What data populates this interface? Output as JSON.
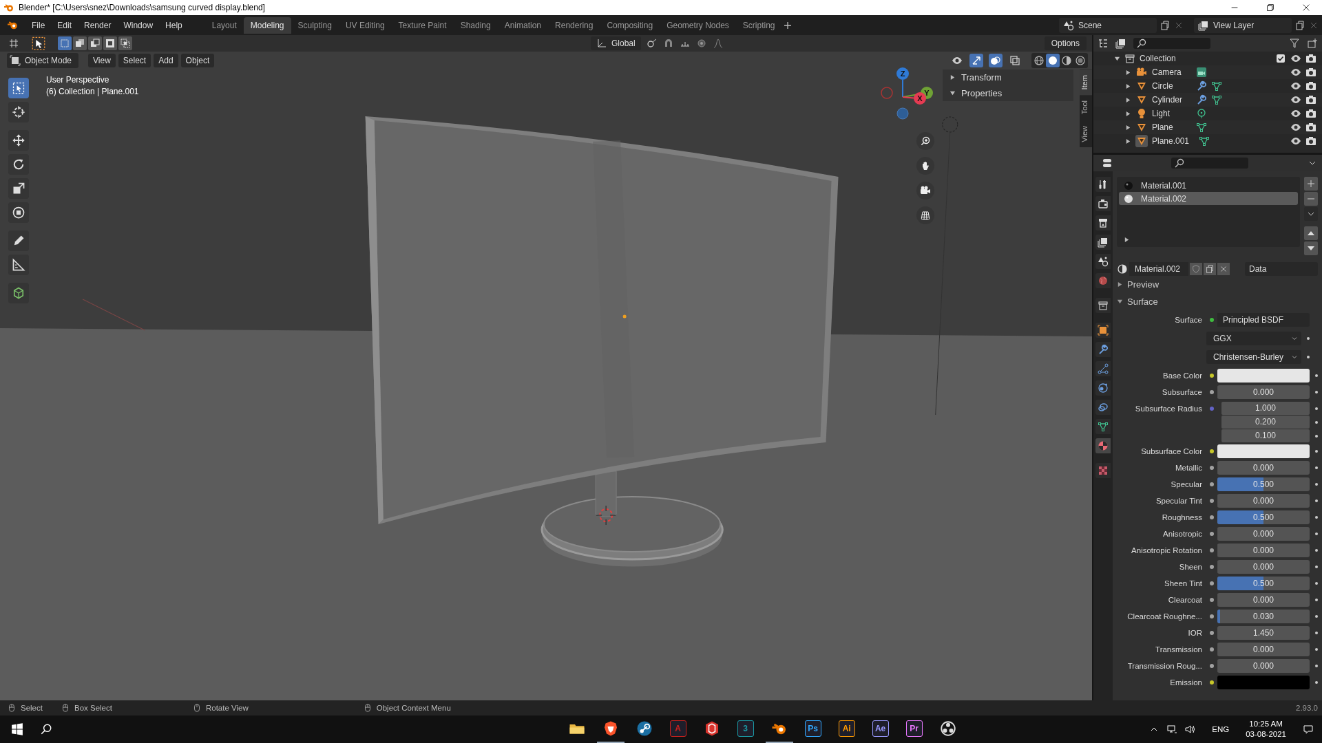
{
  "window": {
    "title": "Blender* [C:\\Users\\snez\\Downloads\\samsung curved display.blend]"
  },
  "menu": [
    "File",
    "Edit",
    "Render",
    "Window",
    "Help"
  ],
  "workspaces": [
    {
      "label": "Layout",
      "selected": false
    },
    {
      "label": "Modeling",
      "selected": true
    },
    {
      "label": "Sculpting",
      "selected": false
    },
    {
      "label": "UV Editing",
      "selected": false
    },
    {
      "label": "Texture Paint",
      "selected": false
    },
    {
      "label": "Shading",
      "selected": false
    },
    {
      "label": "Animation",
      "selected": false
    },
    {
      "label": "Rendering",
      "selected": false
    },
    {
      "label": "Compositing",
      "selected": false
    },
    {
      "label": "Geometry Nodes",
      "selected": false
    },
    {
      "label": "Scripting",
      "selected": false
    }
  ],
  "scene": "Scene",
  "view_layer": "View Layer",
  "viewport": {
    "select_modes": [
      {
        "kind": "sel-new",
        "selected": true
      },
      {
        "kind": "sel-extend",
        "selected": false
      },
      {
        "kind": "sel-subtract",
        "selected": false
      },
      {
        "kind": "sel-invert",
        "selected": false
      },
      {
        "kind": "sel-intersect",
        "selected": false
      }
    ],
    "orientation": "Global",
    "options": "Options",
    "mode": "Object Mode",
    "menus": [
      "View",
      "Select",
      "Add",
      "Object"
    ],
    "toggles": [
      {
        "kind": "eye",
        "on": false
      },
      {
        "kind": "gizmo",
        "on": true
      },
      {
        "kind": "overlay",
        "on": true
      },
      {
        "kind": "xray",
        "on": false
      }
    ],
    "shading": [
      {
        "kind": "wireframe",
        "selected": false
      },
      {
        "kind": "solid",
        "selected": true
      },
      {
        "kind": "material",
        "selected": false
      },
      {
        "kind": "rendered",
        "selected": false
      }
    ],
    "tools": [
      {
        "kind": "select-box",
        "selected": true
      },
      {
        "kind": "cursor",
        "selected": false
      },
      {
        "kind": "move",
        "selected": false
      },
      {
        "kind": "rotate",
        "selected": false
      },
      {
        "kind": "scale",
        "selected": false
      },
      {
        "kind": "transform",
        "selected": false
      },
      {
        "kind": "pencil",
        "selected": false
      },
      {
        "kind": "ruler",
        "selected": false
      },
      {
        "kind": "cube",
        "selected": false
      }
    ],
    "info": [
      "User Perspective",
      "(6) Collection | Plane.001"
    ],
    "axes": [
      {
        "label": "Z",
        "color": "#2f7ad6"
      },
      {
        "label": "Y",
        "color": "#6fa235"
      },
      {
        "label": "X",
        "color": "#e53b52"
      }
    ],
    "panels": [
      {
        "label": "Transform",
        "expanded": false
      },
      {
        "label": "Properties",
        "expanded": true
      }
    ],
    "tabs": [
      {
        "label": "Item",
        "selected": true
      },
      {
        "label": "Tool",
        "selected": false
      },
      {
        "label": "View",
        "selected": false
      }
    ]
  },
  "outliner": {
    "collection": "Collection",
    "items": [
      {
        "name": "Camera",
        "kind": "camera",
        "modifier": false,
        "active": false
      },
      {
        "name": "Circle",
        "kind": "mesh",
        "modifier": true,
        "active": false
      },
      {
        "name": "Cylinder",
        "kind": "mesh",
        "modifier": true,
        "active": false
      },
      {
        "name": "Light",
        "kind": "light",
        "modifier": false,
        "active": false
      },
      {
        "name": "Plane",
        "kind": "mesh",
        "modifier": false,
        "active": false
      },
      {
        "name": "Plane.001",
        "kind": "mesh",
        "modifier": false,
        "active": true
      }
    ]
  },
  "properties": {
    "tabs": [
      {
        "kind": "tool",
        "selected": false
      },
      {
        "kind": "render",
        "selected": false
      },
      {
        "kind": "output",
        "selected": false
      },
      {
        "kind": "view-layer",
        "selected": false
      },
      {
        "kind": "scene",
        "selected": false
      },
      {
        "kind": "world",
        "selected": false
      },
      {
        "kind": "collection",
        "selected": false
      },
      {
        "kind": "object",
        "selected": false
      },
      {
        "kind": "wrench",
        "selected": false
      },
      {
        "kind": "particles",
        "selected": false
      },
      {
        "kind": "physics",
        "selected": false
      },
      {
        "kind": "constraints",
        "selected": false
      },
      {
        "kind": "mesh-data",
        "selected": false
      },
      {
        "kind": "material",
        "selected": true
      },
      {
        "kind": "texture",
        "selected": false
      }
    ],
    "materials": [
      {
        "name": "Material.001",
        "selected": false
      },
      {
        "name": "Material.002",
        "selected": true
      }
    ],
    "material_name": "Material.002",
    "link": "Data",
    "panels": [
      {
        "label": "Preview",
        "expanded": false
      },
      {
        "label": "Surface",
        "expanded": true
      }
    ],
    "rows": [
      {
        "kind": "link",
        "label": "Surface",
        "value": "Principled BSDF",
        "color": "#3fbb3f"
      },
      {
        "kind": "dropdown",
        "value": "GGX"
      },
      {
        "kind": "dropdown",
        "value": "Christensen-Burley"
      },
      {
        "kind": "color",
        "label": "Base Color",
        "color": "#c7c729",
        "swatch": {
          "color": "#e6e6e6"
        }
      },
      {
        "kind": "slider",
        "label": "Subsurface",
        "value": "0.000",
        "level": 0,
        "color": "#a1a1a1"
      },
      {
        "kind": "vector",
        "label": "Subsurface Radius",
        "values": [
          "1.000",
          "0.200",
          "0.100"
        ],
        "color": "#6363c7"
      },
      {
        "kind": "color",
        "label": "Subsurface Color",
        "color": "#c7c729",
        "swatch": {
          "color": "#e6e6e6"
        }
      },
      {
        "kind": "slider",
        "label": "Metallic",
        "value": "0.000",
        "level": 0,
        "color": "#a1a1a1"
      },
      {
        "kind": "slider",
        "label": "Specular",
        "value": "0.500",
        "level": 0.5,
        "color": "#a1a1a1"
      },
      {
        "kind": "slider",
        "label": "Specular Tint",
        "value": "0.000",
        "level": 0,
        "color": "#a1a1a1"
      },
      {
        "kind": "slider",
        "label": "Roughness",
        "value": "0.500",
        "level": 0.5,
        "color": "#a1a1a1"
      },
      {
        "kind": "slider",
        "label": "Anisotropic",
        "value": "0.000",
        "level": 0,
        "color": "#a1a1a1"
      },
      {
        "kind": "slider",
        "label": "Anisotropic Rotation",
        "value": "0.000",
        "level": 0,
        "color": "#a1a1a1"
      },
      {
        "kind": "slider",
        "label": "Sheen",
        "value": "0.000",
        "level": 0,
        "color": "#a1a1a1"
      },
      {
        "kind": "slider",
        "label": "Sheen Tint",
        "value": "0.500",
        "level": 0.5,
        "color": "#a1a1a1"
      },
      {
        "kind": "slider",
        "label": "Clearcoat",
        "value": "0.000",
        "level": 0,
        "color": "#a1a1a1"
      },
      {
        "kind": "slider",
        "label": "Clearcoat Roughne...",
        "value": "0.030",
        "level": 0.03,
        "color": "#a1a1a1"
      },
      {
        "kind": "number",
        "label": "IOR",
        "value": "1.450",
        "color": "#a1a1a1"
      },
      {
        "kind": "slider",
        "label": "Transmission",
        "value": "0.000",
        "level": 0,
        "color": "#a1a1a1"
      },
      {
        "kind": "slider",
        "label": "Transmission Roug...",
        "value": "0.000",
        "level": 0,
        "color": "#a1a1a1"
      },
      {
        "kind": "color",
        "label": "Emission",
        "color": "#c7c729",
        "swatch": {
          "color": "#000000"
        }
      }
    ]
  },
  "status_bar": {
    "hints": [
      "Select",
      "Box Select",
      "Rotate View",
      "Object Context Menu"
    ],
    "version": "2.93.0"
  },
  "taskbar": {
    "apps": [
      {
        "kind": "folder",
        "running": false
      },
      {
        "kind": "shield",
        "running": true
      },
      {
        "kind": "steam",
        "running": false
      },
      {
        "kind": "tile",
        "label": "A",
        "color": "#c9211e",
        "running": false
      },
      {
        "kind": "box-logo",
        "running": false
      },
      {
        "kind": "tile",
        "label": "3",
        "color": "#1b9aa5",
        "running": false
      },
      {
        "kind": "orbit-logo",
        "running": true
      },
      {
        "kind": "tile",
        "label": "Ps",
        "color": "#31a8ff",
        "running": false
      },
      {
        "kind": "tile",
        "label": "Ai",
        "color": "#ff9a00",
        "running": false
      },
      {
        "kind": "tile",
        "label": "Ae",
        "color": "#9999ff",
        "running": false
      },
      {
        "kind": "tile",
        "label": "Pr",
        "color": "#ea77ff",
        "running": false
      },
      {
        "kind": "ring-logo",
        "running": false
      }
    ],
    "language": "ENG",
    "time": "10:25 AM",
    "date": "03-08-2021"
  }
}
